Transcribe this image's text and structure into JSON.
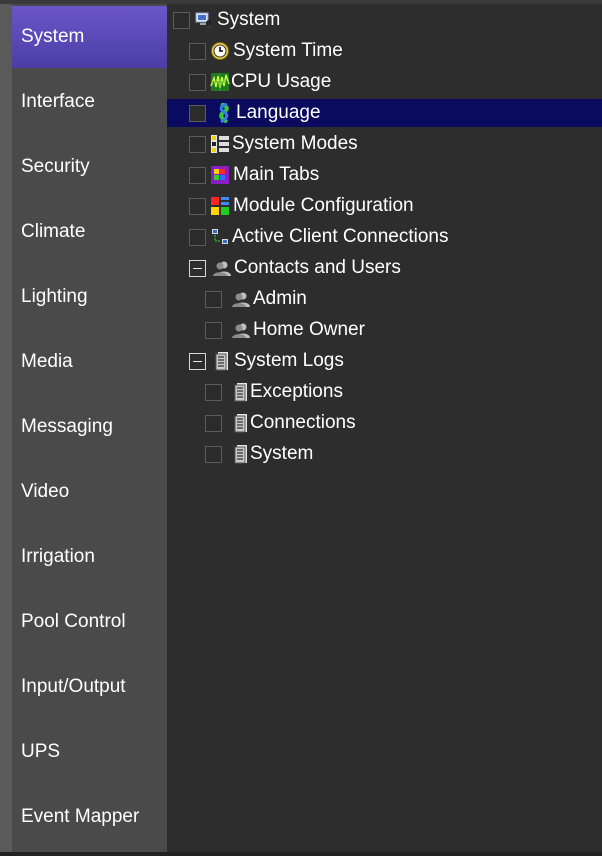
{
  "sidebar": {
    "items": [
      {
        "label": "System",
        "active": true
      },
      {
        "label": "Interface"
      },
      {
        "label": "Security"
      },
      {
        "label": "Climate"
      },
      {
        "label": "Lighting"
      },
      {
        "label": "Media"
      },
      {
        "label": "Messaging"
      },
      {
        "label": "Video"
      },
      {
        "label": "Irrigation"
      },
      {
        "label": "Pool Control"
      },
      {
        "label": "Input/Output"
      },
      {
        "label": "UPS"
      },
      {
        "label": "Event Mapper"
      }
    ]
  },
  "tree": {
    "root": {
      "label": "System",
      "icon": "computer-icon"
    },
    "items": [
      {
        "label": "System Time",
        "icon": "clock-icon"
      },
      {
        "label": "CPU Usage",
        "icon": "cpu-graph-icon"
      },
      {
        "label": "Language",
        "icon": "language-icon",
        "selected": true
      },
      {
        "label": "System Modes",
        "icon": "modes-icon"
      },
      {
        "label": "Main Tabs",
        "icon": "tabs-icon"
      },
      {
        "label": "Module Configuration",
        "icon": "module-icon"
      },
      {
        "label": "Active Client Connections",
        "icon": "network-icon"
      }
    ],
    "contacts": {
      "label": "Contacts and Users",
      "icon": "users-icon",
      "expanded": true,
      "children": [
        {
          "label": "Admin",
          "icon": "user-icon"
        },
        {
          "label": "Home Owner",
          "icon": "user-icon"
        }
      ]
    },
    "logs": {
      "label": "System Logs",
      "icon": "log-icon",
      "expanded": true,
      "children": [
        {
          "label": "Exceptions",
          "icon": "log-icon"
        },
        {
          "label": "Connections",
          "icon": "log-icon"
        },
        {
          "label": "System",
          "icon": "log-icon"
        }
      ]
    }
  },
  "colors": {
    "active_tab": "#5a4bc0",
    "selected_row": "#0a0a5e",
    "sidebar_bg": "#4a4a4a",
    "tree_bg": "#2d2d2d"
  }
}
